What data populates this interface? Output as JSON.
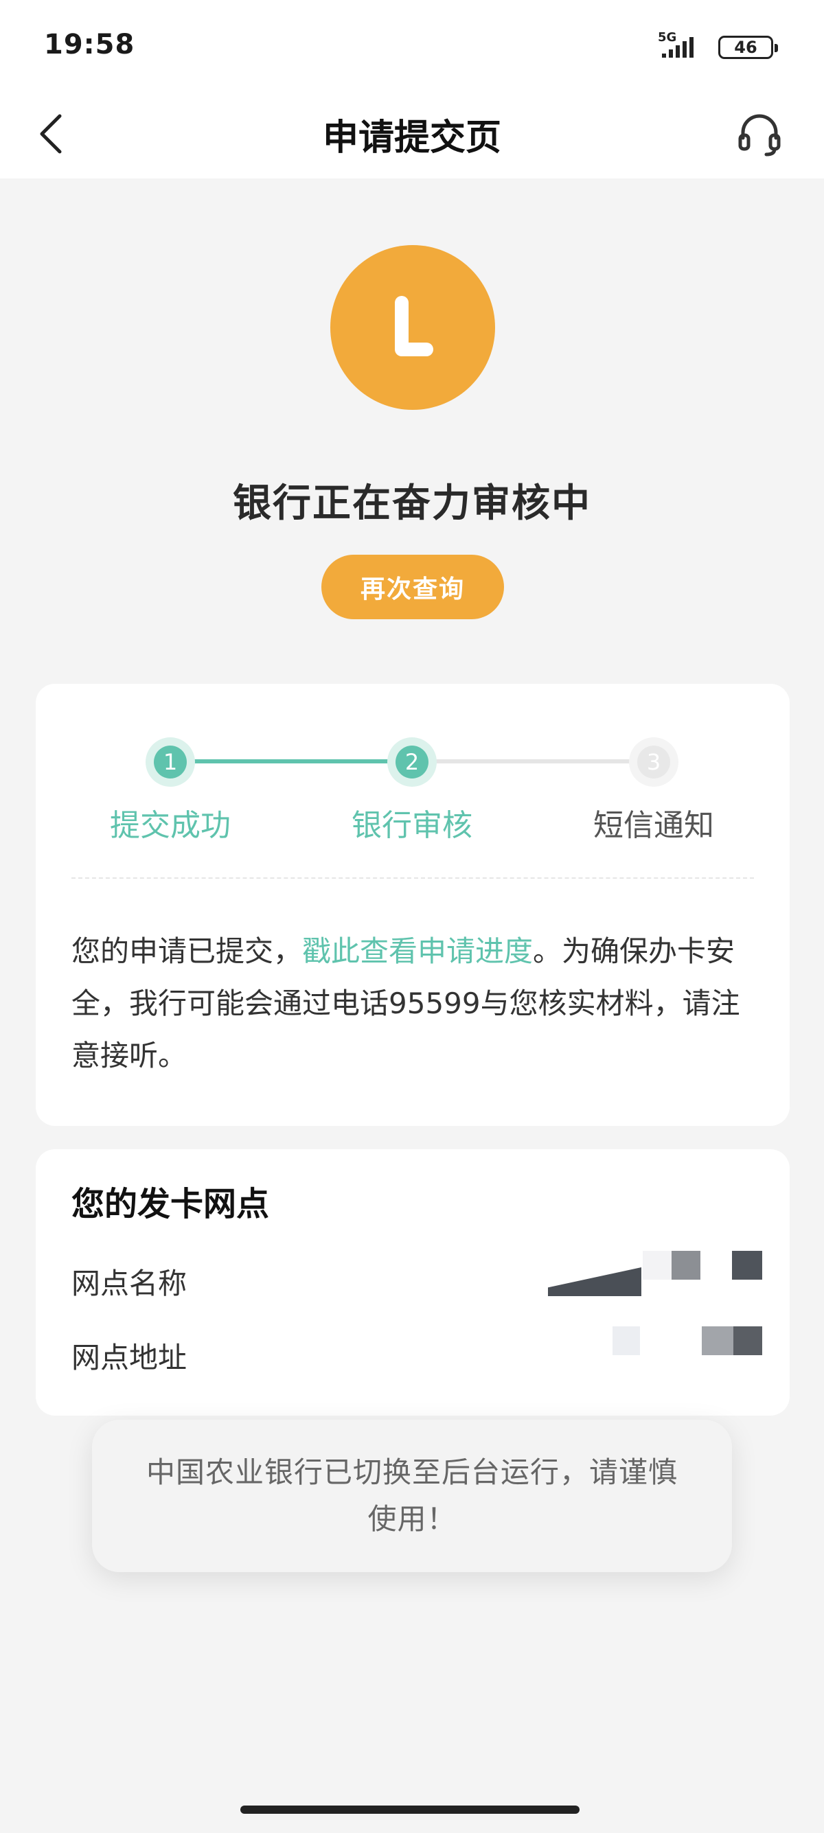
{
  "status_bar": {
    "time": "19:58",
    "network": "5G",
    "battery": "46"
  },
  "nav": {
    "title": "申请提交页",
    "back_icon": "chevron-left-icon",
    "service_icon": "headset-icon"
  },
  "hero": {
    "icon": "clock-icon",
    "status_text": "银行正在奋力审核中",
    "query_button": "再次查询"
  },
  "steps": [
    {
      "number": "1",
      "label": "提交成功",
      "state": "done"
    },
    {
      "number": "2",
      "label": "银行审核",
      "state": "active"
    },
    {
      "number": "3",
      "label": "短信通知",
      "state": "pending"
    }
  ],
  "notice": {
    "prefix": "您的申请已提交，",
    "link": "戳此查看申请进度",
    "suffix": "。为确保办卡安全，我行可能会通过电话95599与您核实材料，请注意接听。"
  },
  "branch": {
    "title": "您的发卡网点",
    "name_label": "网点名称",
    "address_label": "网点地址"
  },
  "toast": {
    "message": "中国农业银行已切换至后台运行，请谨慎使用！"
  },
  "colors": {
    "accent_orange": "#f2aa3b",
    "accent_green": "#5fc3ad",
    "background": "#f4f4f4"
  }
}
